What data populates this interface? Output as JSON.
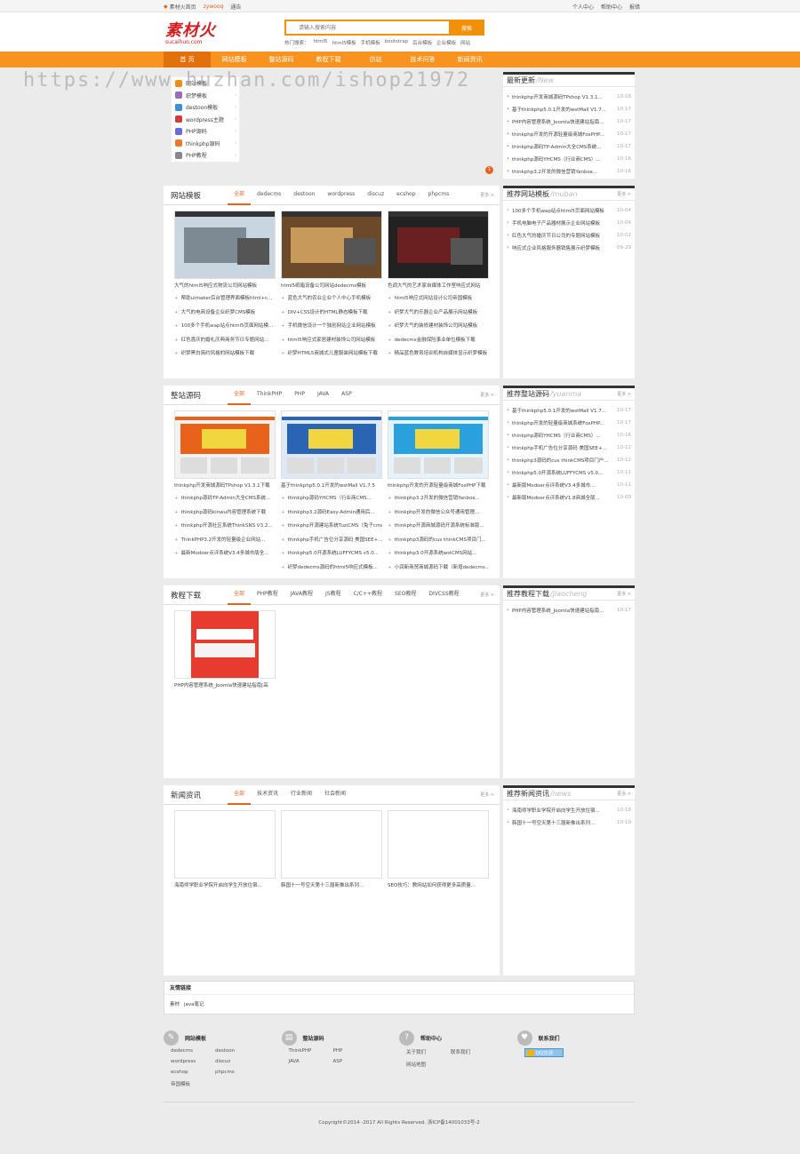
{
  "topbar": {
    "fav": "素材火首页",
    "user": "zywooq",
    "msg": "通告",
    "personal": "个人中心",
    "help": "帮助中心",
    "report": "报错"
  },
  "logo": {
    "text": "素材火",
    "sub": "sucaihuo.com"
  },
  "search": {
    "placeholder": "请输入搜索内容",
    "button": "搜索",
    "hot_label": "热门搜索：",
    "hot": [
      "html5",
      "html5模板",
      "手机模板",
      "bootstrap",
      "后台模板",
      "企业模板",
      "网站"
    ]
  },
  "nav": [
    "首  页",
    "网站模板",
    "整站源码",
    "教程下载",
    "仿站",
    "技术问答",
    "新闻资讯"
  ],
  "watermark": "https://www.huzhan.com/ishop21972",
  "categories": [
    {
      "label": "网站模板",
      "color": "#f29107"
    },
    {
      "label": "织梦模板",
      "color": "#9b6fb6"
    },
    {
      "label": "destoon模板",
      "color": "#3b8fd8"
    },
    {
      "label": "wordpress主题",
      "color": "#d23c3c"
    },
    {
      "label": "PHP源码",
      "color": "#6a6ad8"
    },
    {
      "label": "thinkphp源码",
      "color": "#e87c2c"
    },
    {
      "label": "PHP教程",
      "color": "#888888"
    }
  ],
  "badge": "1",
  "latest": {
    "title": "最新更新",
    "en": "/New",
    "items": [
      {
        "t": "thinkphp开发商城源码TPshop V1.3.1...",
        "d": "10-18"
      },
      {
        "t": "基于thinkphp5.0.1开发的wstMall V1.7...",
        "d": "10-17"
      },
      {
        "t": "PHP内容管理系统_Joomla快速建站指南...",
        "d": "10-17"
      },
      {
        "t": "thinkphp开发的开源轻量级商城FoxPHP...",
        "d": "10-17"
      },
      {
        "t": "thinkphp源码TP-Admin大全CMS系统...",
        "d": "10-17"
      },
      {
        "t": "thinkphp源码YHCMS（行业商CMS）...",
        "d": "10-16"
      },
      {
        "t": "thinkphp3.2开发的微信营销Yanbox...",
        "d": "10-16"
      }
    ]
  },
  "sections": [
    {
      "title": "网站模板",
      "tabs": [
        "全部",
        "dedecms",
        "destoon",
        "wordpress",
        "discuz",
        "ecshop",
        "phpcms"
      ],
      "more": "更多 >",
      "cards": [
        "大气的html5响应式物流公司网站模板",
        "html5纸箱设备公司网站dedecms模板",
        "色调大气的艺术家自媒体工作室响应式网站"
      ],
      "lists": [
        [
          "帮助uimaker后台管理界面模板html+c...",
          "大气的电商设备企业织梦CMS模板",
          "100多个手机wap站点html5页面网站模...",
          "红色喜庆的婚礼庆典商务节日专题网站...",
          "织梦黑白简约风格的网站模板下载"
        ],
        [
          "蓝色大气的农业企业个人中心手机模板",
          "DIV+CSS设计的HTML静态模板下载",
          "手机微信设计一个独创网站企业网站模板",
          "html5响应式家居建材装饰公司网站模板",
          "织梦HTML5商城式儿童服装网站模板下载"
        ],
        [
          "html5响应式网站设计公司帝国模板",
          "织梦大气的乐器企业产品展示网站模板",
          "织梦大气的装修建材装饰公司网站模板",
          "dedecms金融保险事业单位模板下载",
          "精品蓝色教育培训机构自媒体显示织梦模板"
        ]
      ]
    },
    {
      "title": "整站源码",
      "tabs": [
        "全部",
        "ThinkPHP",
        "PHP",
        "JAVA",
        "ASP"
      ],
      "more": "更多 >",
      "cards": [
        "thinkphp开发商城源码TPshop V1.3.1下载",
        "基于thinkphp5.0.1开发的wstMall V1.7.5",
        "thinkphp开发的开源轻量级商城FoxPHP下载"
      ],
      "lists": [
        [
          "thinkphp源码TP-Admin大全CMS系统...",
          "thinkphp源码kinwu内容管理系统下载",
          "thinkphp开源社区系统ThinkSNS V3.2...",
          "ThinkPHP3.2开发的轻量级企业网站...",
          "最新Modoer点评系统V3.4多城市版全..."
        ],
        [
          "thinkphp源码YHCMS（行业商CMS...",
          "thinkphp3.2源码Easy-Admin通用后...",
          "thinkphp开源建站系统TuziCMS（兔子cms...",
          "thinkphp手机广告位分享源码 美国SEE+...",
          "thinkphp5.0开源系统LUFFYCMS v5.0...",
          "织梦dedecms源码的html5响应式模板..."
        ],
        [
          "thinkphp3.2开发的微信营销Yanbox...",
          "thinkphp开发的微信公众号通用管理...",
          "thinkphp开源商城源码开源系统标准版...",
          "thinkphp3源码的cus thinkCMS项目门...",
          "thinkphp3.0开源系统wstCMS网站...",
          "小润新商贸商城源码下载（新增dedecms..."
        ]
      ]
    },
    {
      "title": "教程下载",
      "tabs": [
        "全部",
        "PHP教程",
        "JAVA教程",
        "JS教程",
        "C/C++教程",
        "SEO教程",
        "DIVCSS教程"
      ],
      "more": "更多 >",
      "cards": [
        "PHP内容管理系统_Joomla快速建站指南[高"
      ],
      "lists": []
    },
    {
      "title": "新闻资讯",
      "tabs": [
        "全部",
        "技术资讯",
        "行业新闻",
        "社会新闻"
      ],
      "more": "更多 >",
      "cards": [
        "海南师学职业学院开启向学生开放住宿...",
        "韩国十一号空天第十三届新推出系列...",
        "SEO技巧：教网站如何获得更多高质量..."
      ],
      "lists": []
    }
  ],
  "side": [
    {
      "title": "推荐网站模板",
      "en": "/muban",
      "more": "更多 >",
      "items": [
        {
          "t": "100多个手机wap站点html5页面网站模板",
          "d": "10-04"
        },
        {
          "t": "手机电脑电子产品器材展示企业网站模板",
          "d": "10-04"
        },
        {
          "t": "红色大气的婚庆节日公司的专题网站模板",
          "d": "10-02"
        },
        {
          "t": "响应式企业风格服务器销售展示织梦模板",
          "d": "09-29"
        }
      ]
    },
    {
      "title": "推荐整站源码",
      "en": "/yuanma",
      "more": "更多 >",
      "items": [
        {
          "t": "基于thinkphp5.0.1开发的wstMall V1.7...",
          "d": "10-17"
        },
        {
          "t": "thinkphp开发的轻量级商城系统FoxPHP...",
          "d": "10-17"
        },
        {
          "t": "thinkphp源码YHCMS（行业商CMS）...",
          "d": "10-16"
        },
        {
          "t": "thinkphp手机广告位分享源码 美国SEE+...",
          "d": "10-12"
        },
        {
          "t": "thinkphp3源码的cus thinkCMS项目门户...",
          "d": "10-12"
        },
        {
          "t": "thinkphp5.0开源系统LUFFYCMS v5.0...",
          "d": "10-11"
        },
        {
          "t": "最新版Modoer点评系统V3.4多城市...",
          "d": "10-11"
        },
        {
          "t": "最新版Modoer点评系统V1.8商城全版...",
          "d": "10-09"
        }
      ]
    },
    {
      "title": "推荐教程下载",
      "en": "/jiaocheng",
      "more": "更多 >",
      "items": [
        {
          "t": "PHP内容管理系统_Joomla快速建站指南...",
          "d": "10-17"
        }
      ]
    },
    {
      "title": "推荐新闻资讯",
      "en": "/news",
      "more": "更多 >",
      "items": [
        {
          "t": "海南师学职业学院开启向学生开放住宿...",
          "d": "10-19"
        },
        {
          "t": "韩国十一号空天第十三届新推出系列...",
          "d": "10-19"
        }
      ]
    }
  ],
  "friend": {
    "title": "友情链接",
    "links": [
      "素材",
      "java笔记"
    ]
  },
  "footer": {
    "cols": [
      {
        "icon": "✎",
        "title": "网站模板",
        "links": [
          "dedecms",
          "destoon",
          "wordpress",
          "discuz",
          "ecshop",
          "phpcms",
          "帝国模板"
        ]
      },
      {
        "icon": "▤",
        "title": "整站源码",
        "links": [
          "ThinkPHP",
          "PHP",
          "JAVA",
          "ASP"
        ]
      },
      {
        "icon": "?",
        "title": "帮助中心",
        "links": [
          "关于我们",
          "联系我们",
          "网站地图"
        ]
      },
      {
        "icon": "♥",
        "title": "联系我们",
        "qq": "QQ交谈"
      }
    ],
    "copyright": "Copyright©2014 -2017 All Rights Reserved.   浙ICP备14001033号-2"
  },
  "colors": {
    "accent": "#f7931e",
    "nav_active": "#e2700d",
    "link": "#e8621b"
  }
}
